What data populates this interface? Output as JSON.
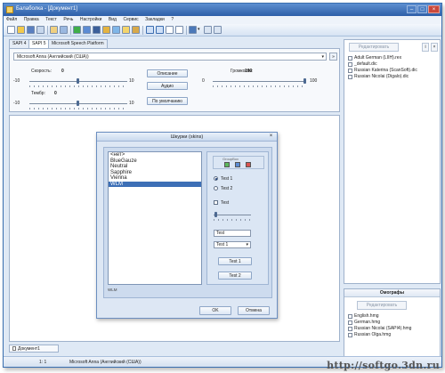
{
  "window": {
    "title": "Балаболка - [Документ1]"
  },
  "menu": [
    "Файл",
    "Правка",
    "Текст",
    "Речь",
    "Настройки",
    "Вид",
    "Сервис",
    "Закладки",
    "?"
  ],
  "tabs": [
    "SAPI 4",
    "SAPI 5",
    "Microsoft Speech Platform"
  ],
  "voice": {
    "selected": "Microsoft Anna (Английский (США))",
    "extra_button": "»"
  },
  "speed": {
    "label": "Скорость:",
    "value": "0",
    "min": "-10",
    "max": "10"
  },
  "pitch": {
    "label": "Тембр:",
    "value": "0",
    "min": "-10",
    "max": "10"
  },
  "volume": {
    "label": "Громкость:",
    "value": "100",
    "min": "0",
    "max": "100"
  },
  "buttons": {
    "describe": "Описание",
    "audio": "Аудио",
    "default": "По умолчанию"
  },
  "dictionaries": {
    "button": "Редактировать",
    "info_icon": "i",
    "close_icon": "×",
    "items": [
      "Adult German (LIIH).rex",
      "_default.dic",
      "Russian Katerina (ScanSoft).dic",
      "Russian Nicolai (Digalo).dic"
    ]
  },
  "homographs": {
    "title": "Омографы",
    "button": "Редактировать",
    "items": [
      "English.hmg",
      "German.hmg",
      "Russian Nicolai (SAPI4).hmg",
      "Russian Olga.hmg"
    ]
  },
  "document_tab": "Документ1",
  "status": {
    "position": "1:     1",
    "voice": "Microsoft Anna (Английский (США))"
  },
  "dialog": {
    "title": "Шкурки (skins)",
    "skins": [
      "<нет>",
      "BlueGauze",
      "Neutral",
      "Sapphire",
      "Vienna",
      "WLM"
    ],
    "selected_skin": "WLM",
    "preview": {
      "caption": "GroupBox",
      "radio1": "Test 1",
      "radio2": "Test 2",
      "checkbox": "Test",
      "edit_value": "Test",
      "combo_value": "Test 1",
      "button1": "Test 1",
      "button2": "Test 2"
    },
    "status": "WLM",
    "ok": "OK",
    "cancel": "Отмена"
  },
  "watermark": "http://softgo.3dn.ru"
}
